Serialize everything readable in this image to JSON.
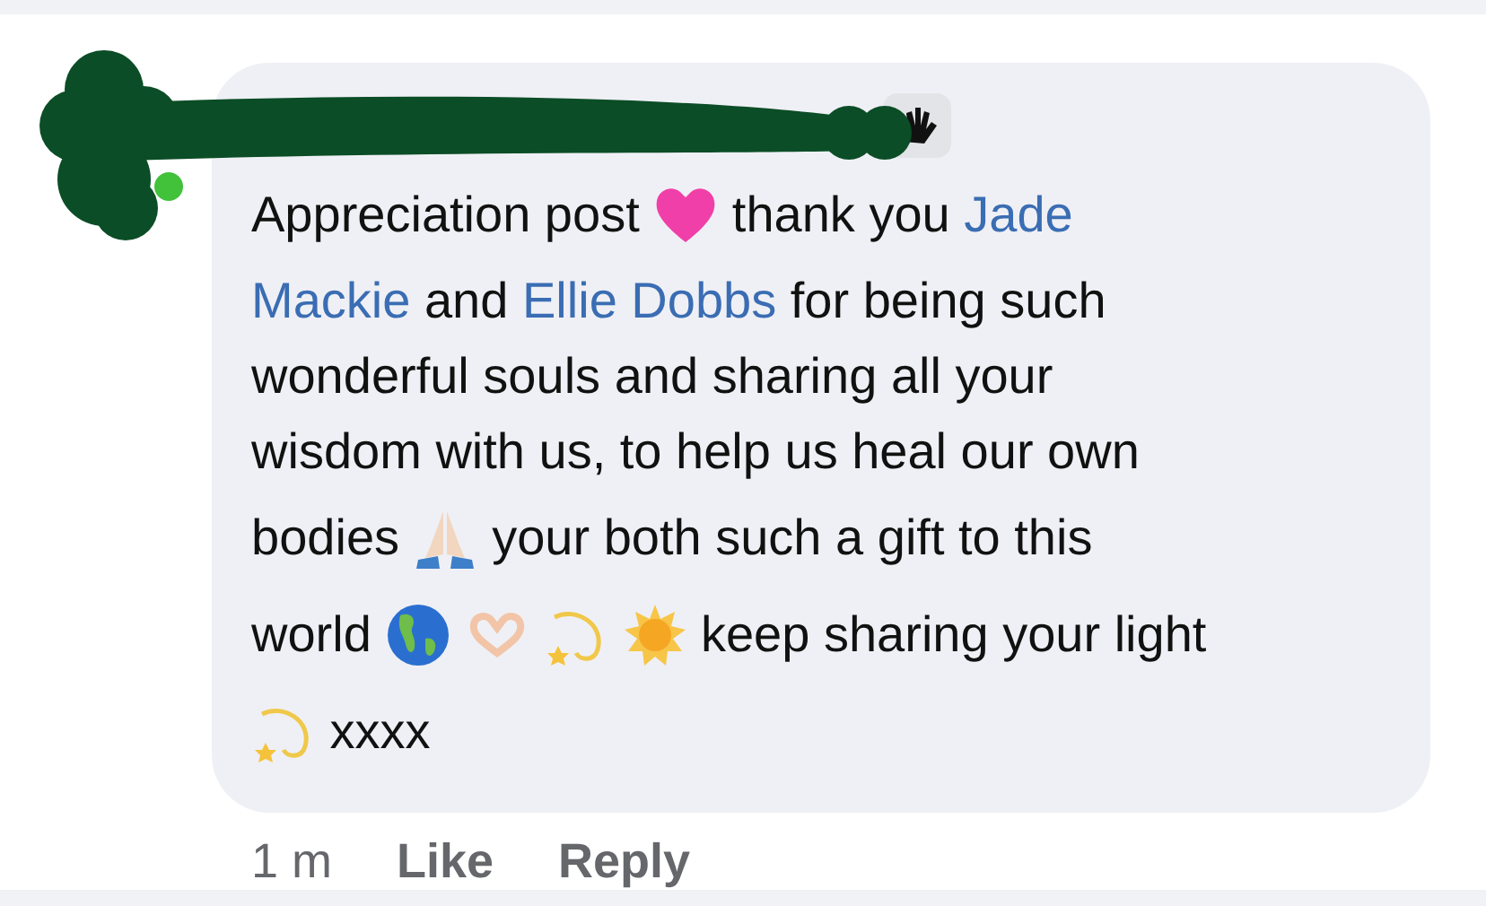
{
  "comment": {
    "lines": [
      [
        {
          "kind": "text",
          "text": "Appreciation post "
        },
        {
          "kind": "heart"
        },
        {
          "kind": "text",
          "text": " thank you "
        },
        {
          "kind": "link",
          "text": "Jade"
        }
      ],
      [
        {
          "kind": "link",
          "text": "Mackie"
        },
        {
          "kind": "text",
          "text": " and "
        },
        {
          "kind": "link",
          "text": "Ellie Dobbs"
        },
        {
          "kind": "text",
          "text": " for being such"
        }
      ],
      [
        {
          "kind": "text",
          "text": "wonderful souls and sharing all your"
        }
      ],
      [
        {
          "kind": "text",
          "text": "wisdom with us, to help us heal our own"
        }
      ],
      [
        {
          "kind": "text",
          "text": "bodies "
        },
        {
          "kind": "pray"
        },
        {
          "kind": "text",
          "text": " your both such a gift to this"
        }
      ],
      [
        {
          "kind": "text",
          "text": "world "
        },
        {
          "kind": "globe"
        },
        {
          "kind": "hearthands"
        },
        {
          "kind": "dizzy"
        },
        {
          "kind": "sun"
        },
        {
          "kind": "text",
          "text": " keep sharing your light"
        }
      ],
      [
        {
          "kind": "dizzy"
        },
        {
          "kind": "text",
          "text": " xxxx"
        }
      ]
    ]
  },
  "footer": {
    "time": "1 m",
    "actions": [
      "Like",
      "Reply"
    ]
  }
}
